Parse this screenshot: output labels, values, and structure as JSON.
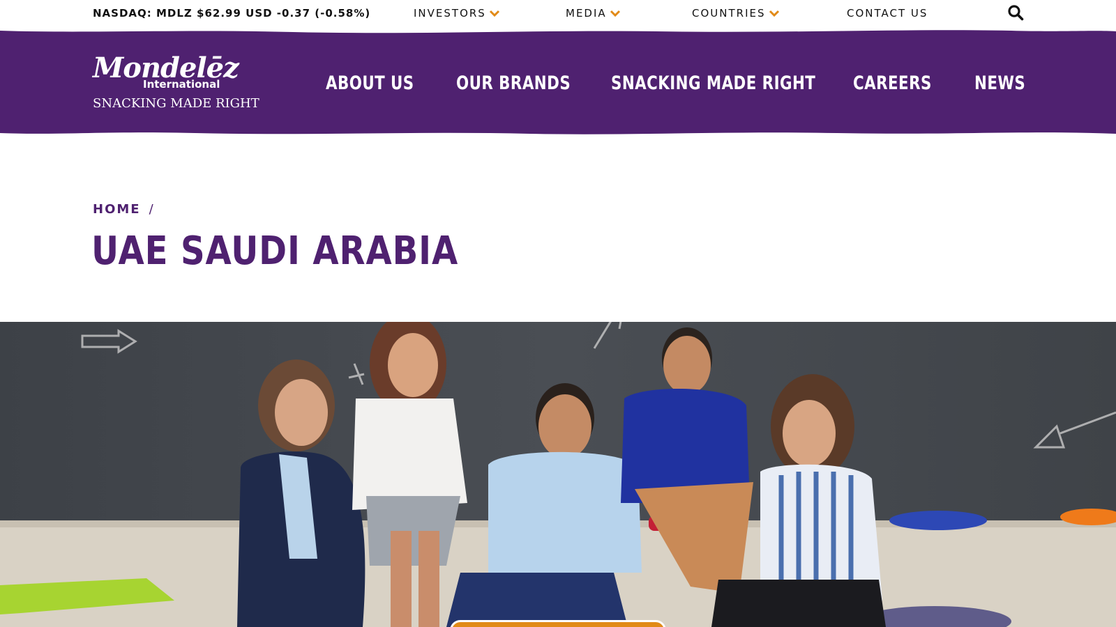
{
  "utility_bar": {
    "stock_ticker": "NASDAQ: MDLZ $62.99 USD -0.37 (-0.58%)",
    "links": [
      {
        "label": "INVESTORS",
        "has_dropdown": true
      },
      {
        "label": "MEDIA",
        "has_dropdown": true
      },
      {
        "label": "COUNTRIES",
        "has_dropdown": true
      },
      {
        "label": "CONTACT US",
        "has_dropdown": false
      }
    ],
    "search_icon": "search-icon"
  },
  "brand": {
    "logo_wordmark": "Mondelēz",
    "logo_sub": "International",
    "logo_tagline": "SNACKING MADE RIGHT"
  },
  "main_nav": {
    "items": [
      {
        "label": "ABOUT US"
      },
      {
        "label": "OUR BRANDS"
      },
      {
        "label": "SNACKING MADE RIGHT"
      },
      {
        "label": "CAREERS"
      },
      {
        "label": "NEWS"
      }
    ]
  },
  "breadcrumb": {
    "home": "HOME",
    "separator": "/"
  },
  "page": {
    "title": "UAE SAUDI ARABIA"
  },
  "colors": {
    "brand_purple": "#4f2170",
    "accent_gold": "#e18a17",
    "white": "#ffffff"
  },
  "hero": {
    "icon": "team-photo-image"
  }
}
